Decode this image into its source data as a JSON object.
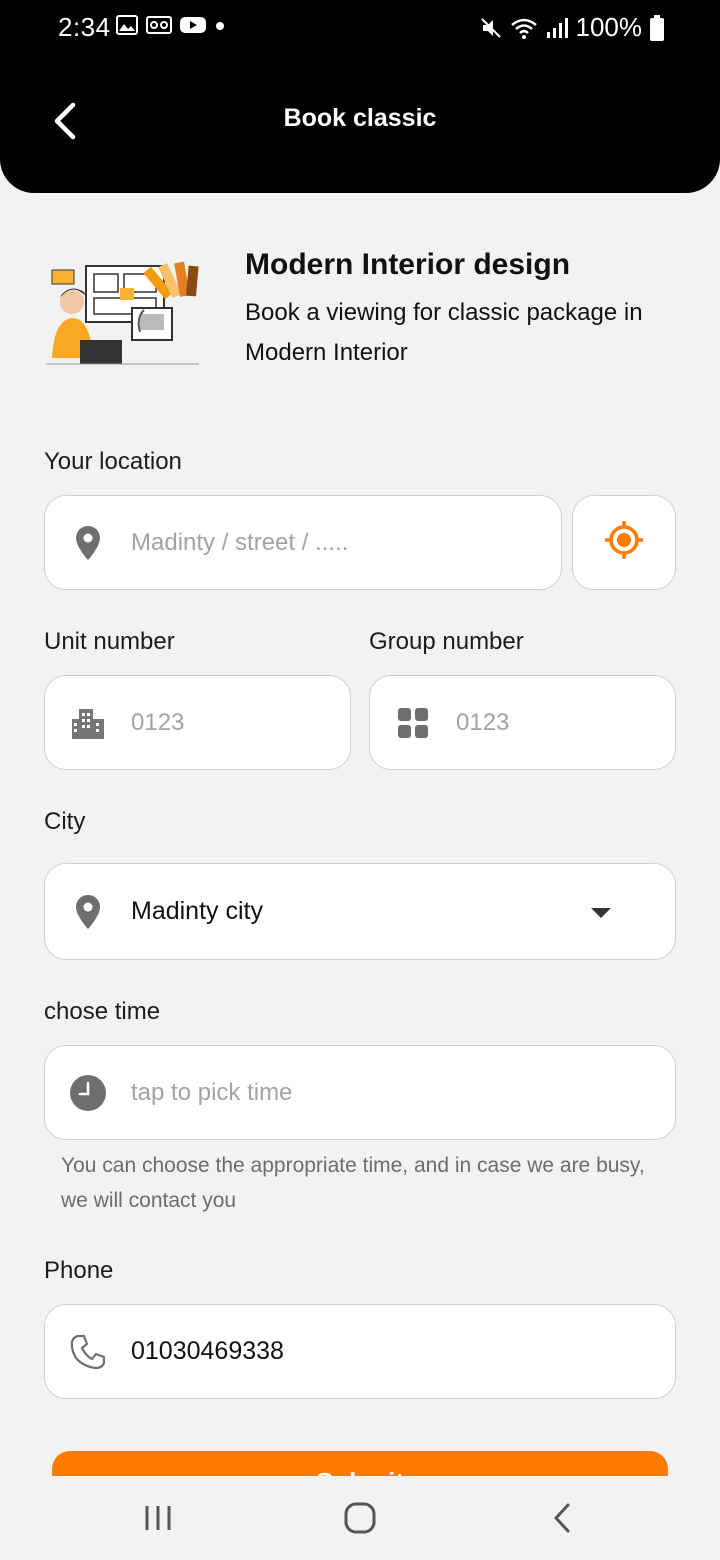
{
  "status_bar": {
    "time": "2:34",
    "battery": "100%",
    "left_icons": [
      "image-icon",
      "voicemail-icon",
      "youtube-icon",
      "dot-icon"
    ],
    "right_icons": [
      "mute-icon",
      "wifi-icon",
      "signal-icon",
      "battery-icon"
    ]
  },
  "app_bar": {
    "title": "Book classic",
    "back_icon": "chevron-left-icon"
  },
  "header": {
    "title": "Modern Interior design",
    "subtitle": "Book a viewing for classic package in Modern Interior"
  },
  "form": {
    "location": {
      "label": "Your location",
      "placeholder": "Madinty / street / .....",
      "icon": "location-pin-icon",
      "gps_icon": "gps-target-icon"
    },
    "unit": {
      "label": "Unit number",
      "placeholder": "0123",
      "icon": "building-icon"
    },
    "group": {
      "label": "Group number",
      "placeholder": "0123",
      "icon": "grid-icon"
    },
    "city": {
      "label": "City",
      "value": "Madinty city",
      "icon": "location-pin-icon"
    },
    "time": {
      "label": "chose time",
      "placeholder": "tap to pick time",
      "icon": "clock-icon",
      "hint": "You can choose the appropriate time, and in case we are busy, we will contact you"
    },
    "phone": {
      "label": "Phone",
      "value": "01030469338",
      "icon": "phone-icon"
    }
  },
  "submit": {
    "label": "Submit"
  },
  "colors": {
    "accent": "#ff7a00",
    "appbar": "#000000",
    "background": "#f2f2f2",
    "field_border": "#cfcfcf",
    "placeholder": "#a3a3a3"
  }
}
